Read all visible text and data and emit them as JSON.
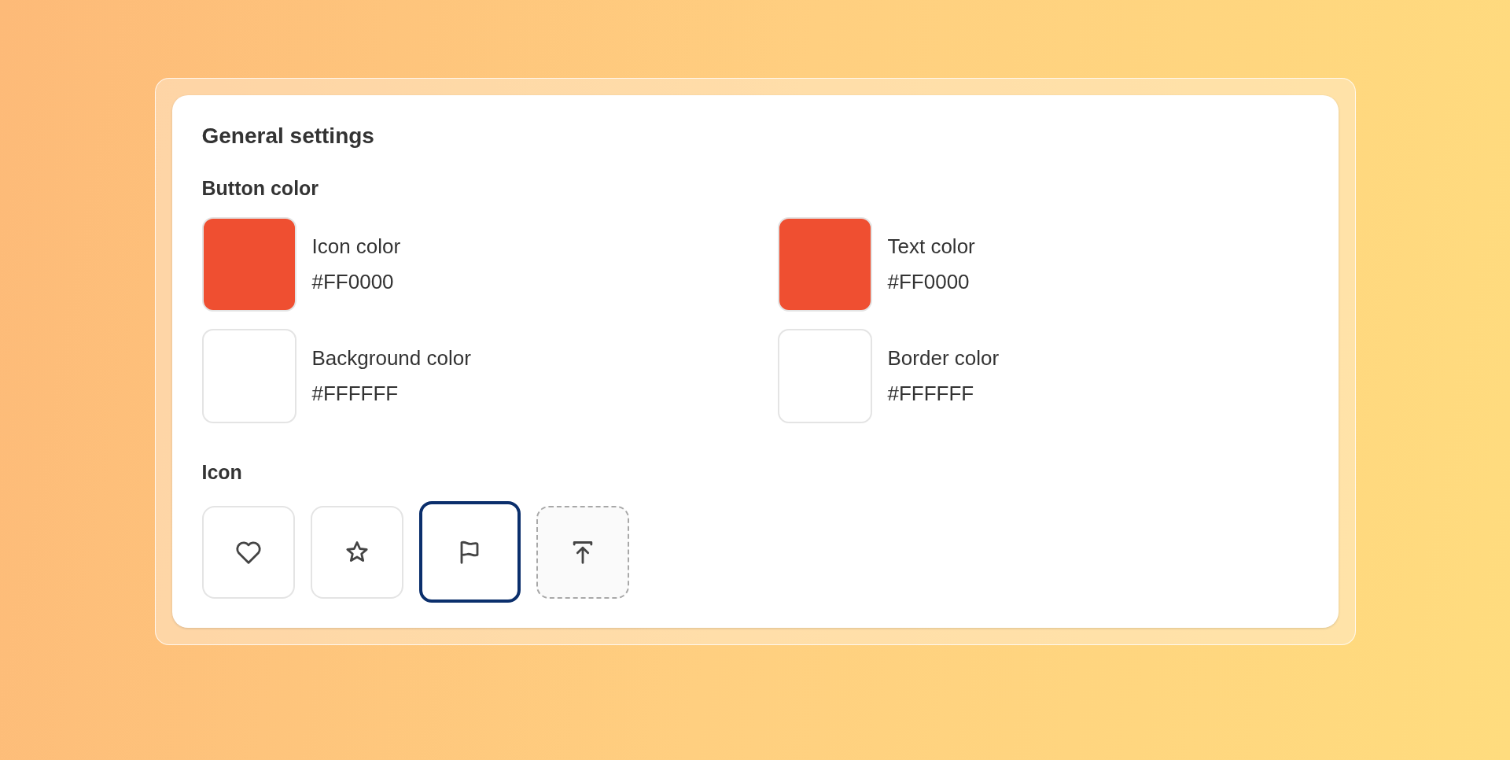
{
  "title": "General settings",
  "button_color": {
    "heading": "Button color",
    "colors": [
      {
        "label": "Icon color",
        "value": "#FF0000",
        "color": "#ef4f31"
      },
      {
        "label": "Text color",
        "value": "#FF0000",
        "color": "#ef4f31"
      },
      {
        "label": "Background color",
        "value": "#FFFFFF",
        "color": "#ffffff"
      },
      {
        "label": "Border color",
        "value": "#FFFFFF",
        "color": "#ffffff"
      }
    ]
  },
  "icon": {
    "heading": "Icon",
    "options": [
      {
        "kind": "heart",
        "selected": false
      },
      {
        "kind": "star",
        "selected": false
      },
      {
        "kind": "flag",
        "selected": true
      },
      {
        "kind": "upload",
        "selected": false
      }
    ]
  }
}
